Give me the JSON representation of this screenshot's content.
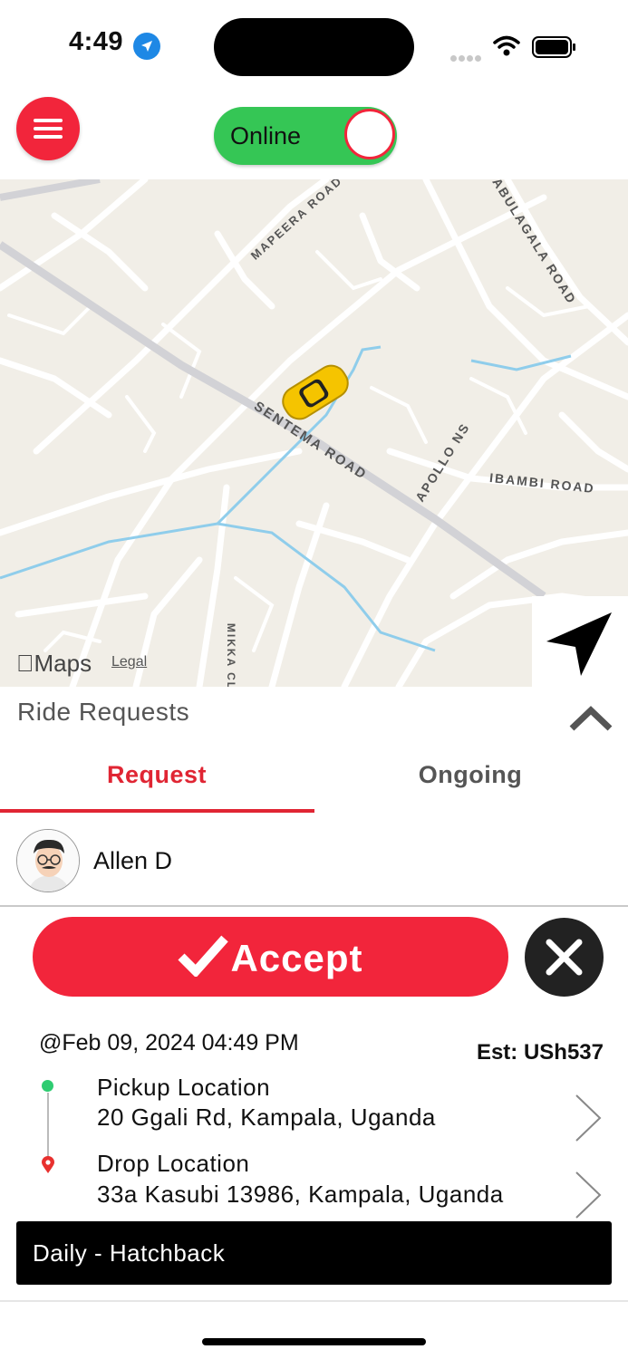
{
  "status_bar": {
    "time": "4:49"
  },
  "header": {
    "toggle_label": "Online"
  },
  "map": {
    "road_labels": [
      "MAPEERA ROAD",
      "NABULAGALA ROAD",
      "SENTEMA ROAD",
      "APOLLO NSIBAMBI ROAD",
      "MIKKA CL"
    ],
    "attribution": "Maps",
    "legal": "Legal"
  },
  "ride_requests": {
    "title": "Ride Requests",
    "tabs": [
      {
        "label": "Request"
      },
      {
        "label": "Ongoing"
      }
    ]
  },
  "request": {
    "rider_name": "Allen D",
    "accept_label": "Accept",
    "datetime": "@Feb 09, 2024 04:49 PM",
    "estimate": "Est: USh537",
    "pickup": {
      "title": "Pickup Location",
      "address": "20 Ggali Rd, Kampala, Uganda"
    },
    "drop": {
      "title": "Drop Location",
      "address": "33a Kasubi 13986, Kampala, Uganda"
    },
    "vehicle": "Daily - Hatchback"
  },
  "colors": {
    "accent": "#f2253b",
    "online": "#35c655",
    "pickup": "#2ecc71"
  }
}
